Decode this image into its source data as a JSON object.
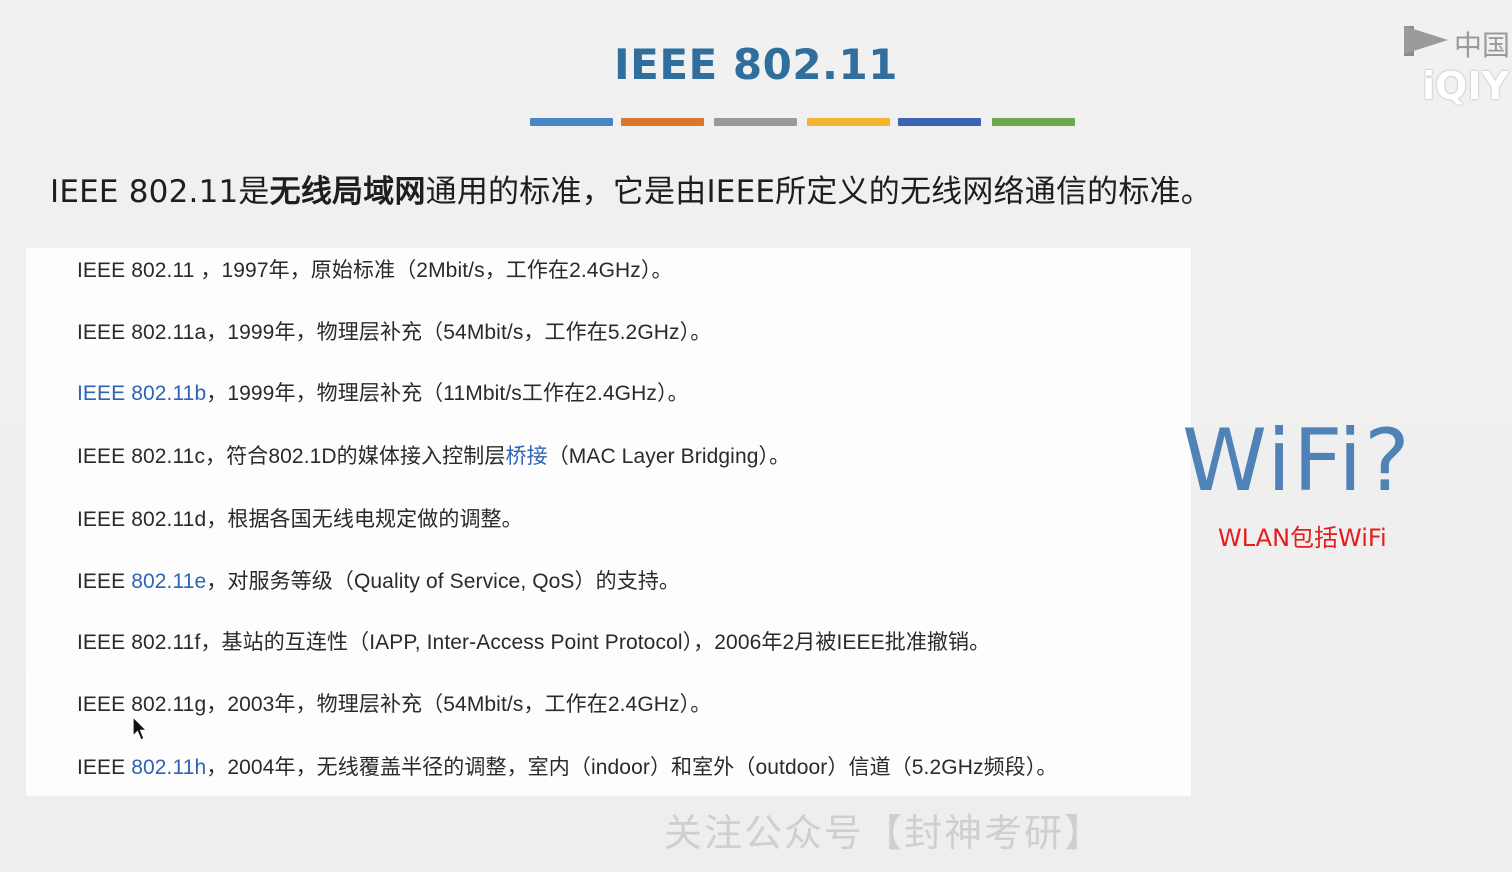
{
  "slide": {
    "title": "IEEE 802.11",
    "bar_colors": [
      "#4a86c4",
      "#d9772c",
      "#9a9a9a",
      "#f2b632",
      "#3e63b0",
      "#6aa84f"
    ],
    "intro": {
      "prefix": "IEEE 802.11是",
      "emphasis": "无线局域网",
      "suffix": "通用的标准，它是由IEEE所定义的无线网络通信的标准。"
    }
  },
  "standards": [
    {
      "segments": [
        {
          "text": "IEEE 802.11 ，1997年，原始标准（2Mbit/s，工作在2.4GHz）。",
          "link": false
        }
      ]
    },
    {
      "segments": [
        {
          "text": "IEEE 802.11a，1999年，物理层补充（54Mbit/s，工作在5.2GHz）。",
          "link": false
        }
      ]
    },
    {
      "segments": [
        {
          "text": "IEEE 802.11b",
          "link": true
        },
        {
          "text": "，1999年，物理层补充（11Mbit/s工作在2.4GHz）。",
          "link": false
        }
      ]
    },
    {
      "segments": [
        {
          "text": "IEEE 802.11c，符合802.1D的媒体接入控制层",
          "link": false
        },
        {
          "text": "桥接",
          "link": true
        },
        {
          "text": "（MAC Layer Bridging）。",
          "link": false
        }
      ]
    },
    {
      "segments": [
        {
          "text": "IEEE 802.11d，根据各国无线电规定做的调整。",
          "link": false
        }
      ]
    },
    {
      "segments": [
        {
          "text": "IEEE ",
          "link": false
        },
        {
          "text": "802.11e",
          "link": true
        },
        {
          "text": "，对服务等级（Quality of Service, QoS）的支持。",
          "link": false
        }
      ]
    },
    {
      "segments": [
        {
          "text": "IEEE 802.11f，基站的互连性（IAPP, Inter-Access Point Protocol），2006年2月被IEEE批准撤销。",
          "link": false
        }
      ]
    },
    {
      "segments": [
        {
          "text": "IEEE 802.11g，2003年，物理层补充（54Mbit/s，工作在2.4GHz）。",
          "link": false
        }
      ]
    },
    {
      "segments": [
        {
          "text": "IEEE ",
          "link": false
        },
        {
          "text": "802.11h",
          "link": true
        },
        {
          "text": "，2004年，无线覆盖半径的调整，室内（indoor）和室外（outdoor）信道（5.2GHz频段）。",
          "link": false
        }
      ]
    }
  ],
  "side": {
    "wifi": "WiFi?",
    "note": "WLAN包括WiFi"
  },
  "watermark": "关注公众号【封神考研】",
  "logo": {
    "cn": "中国",
    "brand": "iQIY",
    "icon": "iqiyi-flag-icon"
  },
  "cursor_icon": "mouse-pointer-icon"
}
